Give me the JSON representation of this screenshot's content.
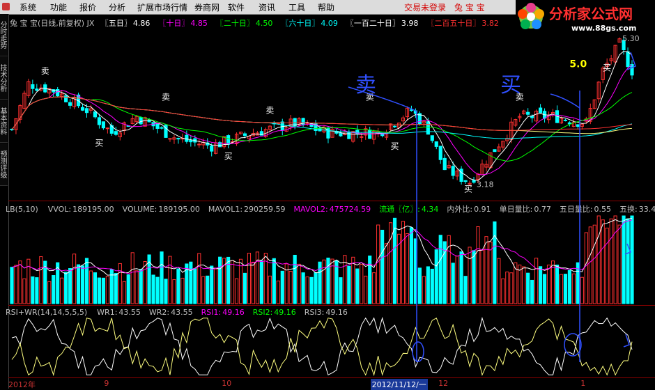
{
  "menu": [
    "系统",
    "功能",
    "报价",
    "分析",
    "扩展市场行情",
    "券商网",
    "软件",
    "资讯",
    "工具",
    "帮助"
  ],
  "status": {
    "login": "交易未登录",
    "stock": "兔 宝 宝"
  },
  "brand": {
    "name": "分析家公式网",
    "url": "www.88gs.com"
  },
  "sidebar_tabs": [
    "分时走势",
    "技术分析",
    "基本资料",
    "预测评级"
  ],
  "price_panel": {
    "title": "兔 宝 宝(日线,前复权) JX",
    "ma": [
      {
        "label": "〖五日〗",
        "value": "4.86",
        "color": "#ffffff"
      },
      {
        "label": "〖十日〗",
        "value": "4.85",
        "color": "#ff00ff"
      },
      {
        "label": "〖二十日〗",
        "value": "4.50",
        "color": "#00ff00"
      },
      {
        "label": "〖六十日〗",
        "value": "4.09",
        "color": "#00ffff"
      },
      {
        "label": "〖一百二十日〗",
        "value": "3.98",
        "color": "#ffffff"
      },
      {
        "label": "〖二百五十日〗",
        "value": "3.82",
        "color": "#ff3030"
      }
    ],
    "high_label": "5.30",
    "low_label": "3.18",
    "level_label": "5.0",
    "sell_label": "卖",
    "buy_label": "买",
    "hand_sell": "卖",
    "hand_buy": "买"
  },
  "volume_panel": {
    "items": [
      {
        "label": "LB(5,10)",
        "value": "",
        "color": "#c0c0c0"
      },
      {
        "label": "VVOL:",
        "value": "189195.00",
        "color": "#c0c0c0"
      },
      {
        "label": "VOLUME:",
        "value": "189195.00",
        "color": "#c0c0c0"
      },
      {
        "label": "MAVOL1:",
        "value": "290259.59",
        "color": "#c0c0c0"
      },
      {
        "label": "MAVOL2:",
        "value": "475724.59",
        "color": "#ff00ff"
      },
      {
        "label": "流通〖亿〗:",
        "value": "4.34",
        "color": "#00ff00"
      },
      {
        "label": "内外比:",
        "value": "0.91",
        "color": "#c0c0c0"
      },
      {
        "label": "单日量比:",
        "value": "0.77",
        "color": "#c0c0c0"
      },
      {
        "label": "五日量比:",
        "value": "0.55",
        "color": "#c0c0c0"
      },
      {
        "label": "五换:",
        "value": "33.4",
        "color": "#c0c0c0"
      }
    ]
  },
  "rsi_panel": {
    "items": [
      {
        "label": "RSI+WR(14,14,5,5,5)",
        "value": "",
        "color": "#c0c0c0"
      },
      {
        "label": "WR1:",
        "value": "43.55",
        "color": "#c0c0c0"
      },
      {
        "label": "WR2:",
        "value": "43.55",
        "color": "#c0c0c0"
      },
      {
        "label": "RSI1:",
        "value": "49.16",
        "color": "#ff00ff"
      },
      {
        "label": "RSI2:",
        "value": "49.16",
        "color": "#00ff00"
      },
      {
        "label": "RSI3:",
        "value": "49.16",
        "color": "#c0c0c0"
      }
    ]
  },
  "x_axis": [
    {
      "label": "2012年",
      "x": 0.0
    },
    {
      "label": "9",
      "x": 0.148
    },
    {
      "label": "10",
      "x": 0.33
    },
    {
      "label": "2012/11/12/一",
      "x": 0.56,
      "highlight": true
    },
    {
      "label": "12",
      "x": 0.665
    },
    {
      "label": "1",
      "x": 0.885
    }
  ],
  "colors": {
    "up": "#ff3030",
    "down": "#00ffff",
    "panel_border": "#8b0000"
  }
}
